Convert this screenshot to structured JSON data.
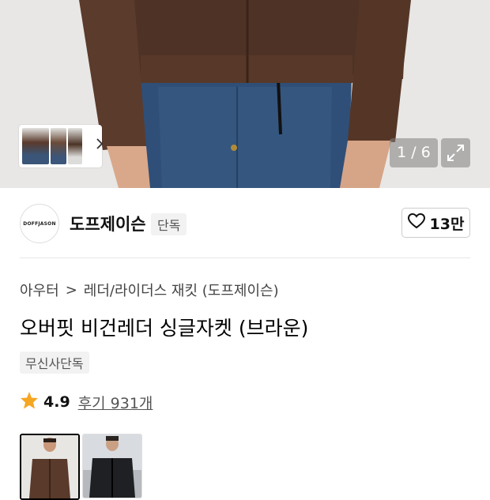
{
  "gallery": {
    "counter": "1 / 6",
    "icons": {
      "next": "chevron-right-icon",
      "expand": "expand-icon"
    }
  },
  "brand": {
    "logo_text": "DOFFJASON",
    "name": "도프제이슨",
    "exclusive_badge": "단독",
    "likes": "13만",
    "like_icon": "heart-outline-icon"
  },
  "breadcrumb": {
    "level1": "아우터",
    "separator": ">",
    "level2": "레더/라이더스 재킷 (도프제이슨)"
  },
  "product": {
    "title": "오버핏 비건레더 싱글자켓 (브라운)",
    "tag": "무신사단독",
    "rating": "4.9",
    "reviews": "후기 931개",
    "star_color": "#F5A623"
  },
  "variants": [
    {
      "name": "브라운",
      "selected": true
    },
    {
      "name": "블랙",
      "selected": false
    }
  ]
}
